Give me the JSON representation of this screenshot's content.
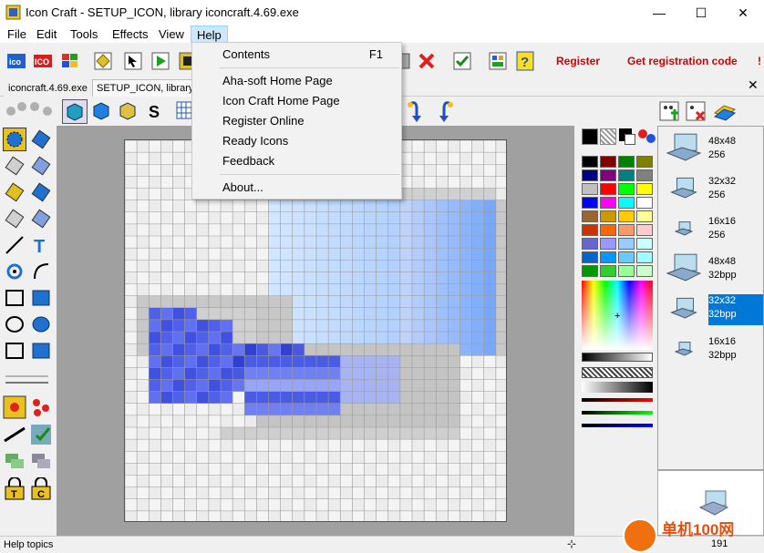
{
  "window": {
    "title": "Icon Craft - SETUP_ICON, library iconcraft.4.69.exe",
    "min": "—",
    "max": "☐",
    "close": "✕"
  },
  "menubar": [
    "File",
    "Edit",
    "Tools",
    "Effects",
    "View",
    "Help"
  ],
  "toolbar": {
    "register": "Register",
    "get_code": "Get registration code",
    "bang": "!"
  },
  "doc_tabs": [
    "iconcraft.4.69.exe",
    "SETUP_ICON, library"
  ],
  "help_menu": {
    "items": [
      {
        "label": "Contents",
        "shortcut": "F1"
      },
      {
        "label": "Aha-soft Home Page"
      },
      {
        "label": "Icon Craft Home Page"
      },
      {
        "label": "Register Online"
      },
      {
        "label": "Ready Icons"
      },
      {
        "label": "Feedback"
      },
      {
        "label": "About..."
      }
    ]
  },
  "formats": [
    {
      "size": "48x48",
      "depth": "256"
    },
    {
      "size": "32x32",
      "depth": "256"
    },
    {
      "size": "16x16",
      "depth": "256"
    },
    {
      "size": "48x48",
      "depth": "32bpp"
    },
    {
      "size": "32x32",
      "depth": "32bpp",
      "selected": true
    },
    {
      "size": "16x16",
      "depth": "32bpp"
    }
  ],
  "palette_colors": [
    "#000000",
    "#800000",
    "#008000",
    "#808000",
    "#000080",
    "#800080",
    "#008080",
    "#808080",
    "#c0c0c0",
    "#ff0000",
    "#00ff00",
    "#ffff00",
    "#0000ff",
    "#ff00ff",
    "#00ffff",
    "#ffffff",
    "#996633",
    "#cc9900",
    "#ffcc00",
    "#ffff99",
    "#cc3300",
    "#ff6600",
    "#ff9966",
    "#ffcccc",
    "#6666cc",
    "#9999ff",
    "#99ccff",
    "#ccffff",
    "#0066cc",
    "#0099ff",
    "#66ccff",
    "#99ffff",
    "#009900",
    "#33cc33",
    "#99ff99",
    "#ccffcc"
  ],
  "status": {
    "text": "Help topics",
    "zoom": "191"
  },
  "watermark": "单机100网"
}
